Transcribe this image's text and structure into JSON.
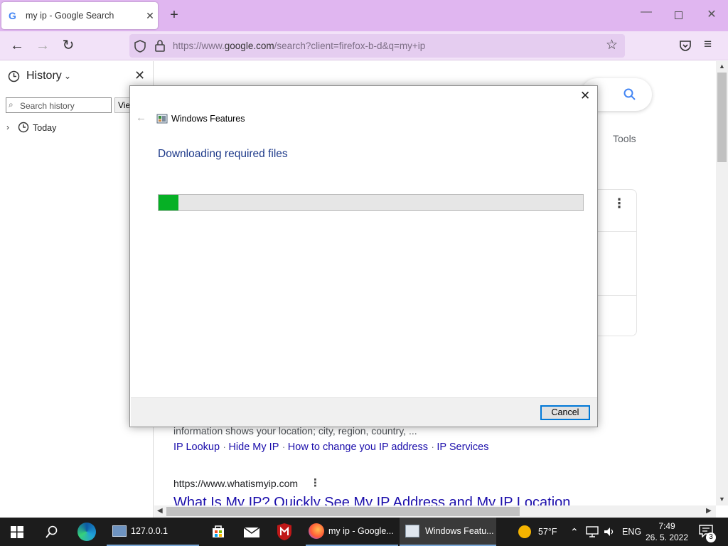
{
  "browser": {
    "tab_title": "my ip - Google Search",
    "tab_favicon": "G",
    "url_prefix": "https://www.",
    "url_domain": "google.com",
    "url_suffix": "/search?client=firefox-b-d&q=my+ip"
  },
  "sidebar": {
    "title": "History",
    "search_placeholder": "Search history",
    "view_button": "Vie",
    "group_today": "Today"
  },
  "page": {
    "tools_label": "Tools",
    "snippet": "information shows your location; city, region, country, ...",
    "sublinks": [
      "IP Lookup",
      "Hide My IP",
      "How to change you IP address",
      "IP Services"
    ],
    "result2_url": "https://www.whatismyip.com",
    "result2_title": "What Is My IP? Quickly See My IP Address and My IP Location"
  },
  "dialog": {
    "title": "Windows Features",
    "heading": "Downloading required files",
    "progress_fraction": 0.047,
    "cancel_label": "Cancel"
  },
  "taskbar": {
    "item_ip": "127.0.0.1",
    "item_firefox": "my ip - Google...",
    "item_features": "Windows Featu...",
    "weather_temp": "57°F",
    "language": "ENG",
    "time": "7:49",
    "date": "26. 5. 2022",
    "notification_count": "3"
  },
  "colors": {
    "tabbar_bg": "#e0b6f0",
    "navbar_bg": "#f2e2f8",
    "progress_fill": "#06b025",
    "dialog_heading": "#1e3a8a",
    "accent_blue": "#0078d7"
  }
}
